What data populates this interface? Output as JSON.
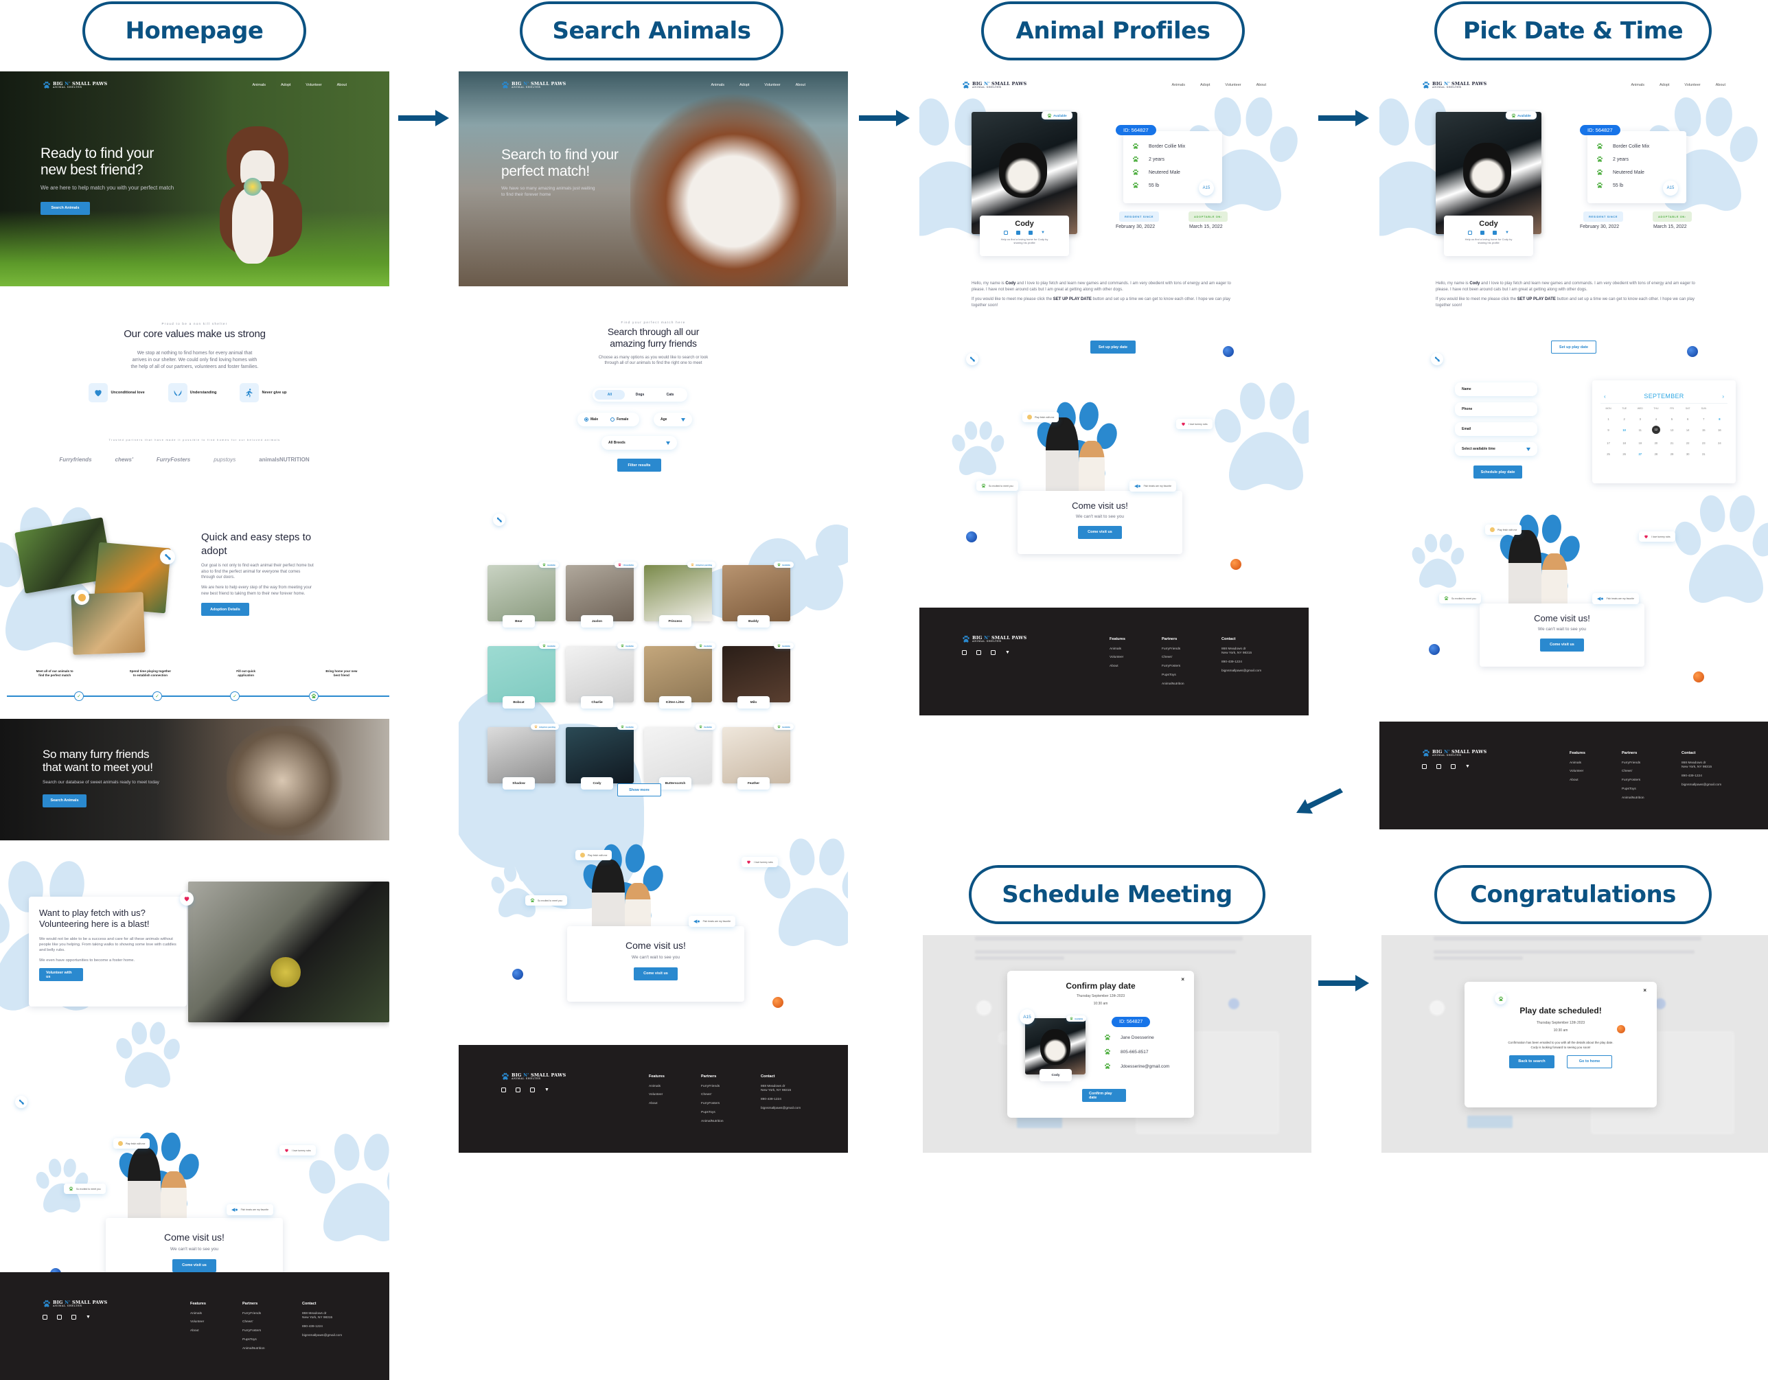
{
  "flow": {
    "stages": [
      {
        "label": "Homepage"
      },
      {
        "label": "Search Animals"
      },
      {
        "label": "Animal Profiles"
      },
      {
        "label": "Pick Date & Time"
      },
      {
        "label": "Schedule Meeting"
      },
      {
        "label": "Congratulations"
      }
    ],
    "accent_color": "#0b5282"
  },
  "brand": {
    "name_part1": "BIG ",
    "name_accent": "N'",
    "name_part2": " SMALL PAWS",
    "subtitle": "ANIMAL SHELTER",
    "primary_color": "#2a89cf"
  },
  "nav": {
    "links": [
      "Animals",
      "Adopt",
      "Volunteer",
      "About"
    ]
  },
  "home": {
    "hero": {
      "title_line1": "Ready to find your",
      "title_line2": "new best friend?",
      "subtitle": "We are here to help match you with your perfect match",
      "cta": "Search Animals"
    },
    "values": {
      "eyebrow": "Proud to be a non kill shelter",
      "title": "Our core values make us strong",
      "body_line1": "We stop at nothing to find homes for every animal that",
      "body_line2": "arrives in our shelter. We could only find loving homes with",
      "body_line3": "the help of all of our partners, volunteers and foster families.",
      "items": [
        {
          "label": "Unconditional love",
          "icon": "heart-icon"
        },
        {
          "label": "Understanding",
          "icon": "hands-icon"
        },
        {
          "label": "Never give up",
          "icon": "running-icon"
        }
      ]
    },
    "partners": {
      "eyebrow": "Trusted partners that have made it possible to find homes for our beloved animals",
      "logos": [
        "Furryfriends",
        "chews'",
        "FurryFosters",
        "pupstoys",
        "animalsNUTRITION"
      ]
    },
    "steps": {
      "title_line1": "Quick and easy steps to",
      "title_line2": "adopt",
      "para1": "Our goal is not only to find each animal their perfect home but also to find the perfect animal for everyone that comes through our doors.",
      "para2": "We are here to help every step of the way from meeting your new best friend to taking them to their new forever home.",
      "cta": "Adoption Details",
      "items": [
        {
          "line1": "Meet all of our animals to",
          "line2": "find the perfect match",
          "icon": "check-icon"
        },
        {
          "line1": "Spend time playing together",
          "line2": "to establish connection",
          "icon": "check-icon"
        },
        {
          "line1": "Fill out quick",
          "line2": "application",
          "icon": "check-icon"
        },
        {
          "line1": "Bring home your new",
          "line2": "best friend",
          "icon": "paw-icon"
        }
      ]
    },
    "banner": {
      "title_line1": "So many furry friends",
      "title_line2": "that want to meet you!",
      "subtitle": "Search our database of sweet animals ready to meet today",
      "cta": "Search Animals"
    },
    "volunteer": {
      "title_line1": "Want to play fetch with us?",
      "title_line2": "Volunteering here is a blast!",
      "para1": "We would not be able to be a success and care for all these animals without people like you helping. From taking walks to showing some love with cuddles and belly rubs.",
      "para2": "We even have opportunities to become a foster home.",
      "cta": "Volunteer with us"
    }
  },
  "visit": {
    "title": "Come visit us!",
    "subtitle": "We can't wait to see you",
    "cta": "Come visit us",
    "bubbles": [
      "Play fetch with me",
      "I love tummy rubs",
      "So excited to meet you",
      "Fish treats are my favorite"
    ]
  },
  "search": {
    "hero": {
      "title_line1": "Search to find your",
      "title_line2": "perfect match!",
      "subtitle_line1": "We have so many amazing animals just waiting",
      "subtitle_line2": "to find their forever home"
    },
    "eyebrow": "Find your perfect match here",
    "title_line1": "Search through all our",
    "title_line2": "amazing furry friends",
    "subtitle_line1": "Choose as many options as you would like to search or look",
    "subtitle_line2": "through all of our animals to find the right one to meet",
    "type_tabs": [
      {
        "label": "All",
        "active": true
      },
      {
        "label": "Dogs",
        "active": false
      },
      {
        "label": "Cats",
        "active": false
      }
    ],
    "gender": {
      "options": [
        "Male",
        "Female"
      ],
      "selected": "Male"
    },
    "age_select": "Age",
    "breed_select": "All Breeds",
    "filter_cta": "Filter results",
    "show_more": "Show more",
    "animals": [
      {
        "name": "Bear",
        "status": "Available"
      },
      {
        "name": "Jaxlon",
        "status": "Unavailable"
      },
      {
        "name": "Princess",
        "status": "Adoption pending"
      },
      {
        "name": "Buddy",
        "status": "Available"
      },
      {
        "name": "Bobcat",
        "status": "Available"
      },
      {
        "name": "Charlie",
        "status": "Available"
      },
      {
        "name": "Kitten Litter",
        "status": "Available"
      },
      {
        "name": "Milo",
        "status": "Available"
      },
      {
        "name": "Shadow",
        "status": "Adoption pending"
      },
      {
        "name": "Cody",
        "status": "Available"
      },
      {
        "name": "Butterscotch",
        "status": "Available"
      },
      {
        "name": "Feather",
        "status": "Available"
      }
    ],
    "status_colors": {
      "Available": "#52b044",
      "Unavailable": "#e6245b",
      "Adoption pending": "#f2b450"
    }
  },
  "profile": {
    "name": "Cody",
    "status": "Available",
    "share_text_line1": "Help us find a loving home for Cody by",
    "share_text_line2": "sharing his profile",
    "id": "ID: 564827",
    "kennel": "A15",
    "details": [
      "Border Collie Mix",
      "2 years",
      "Neutered Male",
      "55 lb"
    ],
    "resident_since_label": "RESIDENT SINCE",
    "resident_since": "February 30, 2022",
    "adoptable_on_label": "ADOPTABLE ON:",
    "adoptable_on": "March 15, 2022",
    "bio_pre": "Hello, my name is ",
    "bio_name": "Cody",
    "bio_post": " and I love to play fetch and learn new games and commands. I am very obedient with tons of energy and am eager to please. I have not been around cats but I am great at getting along with other dogs.",
    "bio2_pre": "If you would like to meet me please click the ",
    "bio2_bold": "SET UP PLAY DATE",
    "bio2_post": " button and set up a time we can get to know each other. I hope we can play together soon!",
    "cta": "Set up play date"
  },
  "schedule_form": {
    "name_placeholder": "Name",
    "phone_placeholder": "Phone",
    "email_placeholder": "Email",
    "time_select": "Select available time",
    "cta": "Schedule play date"
  },
  "calendar": {
    "month": "SEPTEMBER",
    "weekdays": [
      "MON",
      "TUE",
      "WED",
      "THU",
      "FRI",
      "SAT",
      "SUN",
      ""
    ],
    "days": [
      [
        "1",
        "2",
        "3",
        "4",
        "5",
        "6",
        "7",
        "8"
      ],
      [
        "9",
        "10",
        "11",
        "12",
        "13",
        "14",
        "15",
        "16"
      ],
      [
        "17",
        "18",
        "19",
        "20",
        "21",
        "22",
        "23",
        "24"
      ],
      [
        "25",
        "26",
        "27",
        "28",
        "29",
        "30",
        "31",
        ""
      ]
    ],
    "highlighted": [
      "8",
      "10",
      "27"
    ],
    "selected": "12"
  },
  "confirm_modal": {
    "title": "Confirm play date",
    "date": "Thursday September 12th 2023",
    "time": "10:30 am",
    "id": "ID: 564827",
    "kennel": "A15",
    "status": "Available",
    "animal_name": "Cody",
    "contact": [
      "Jane Doesserine",
      "805-665-8517",
      "Jdoesserine@gmail.com"
    ],
    "cta": "Confirm play date",
    "close": "×"
  },
  "success_modal": {
    "title": "Play date scheduled!",
    "date": "Thursday September 12th 2023",
    "time": "10:30 am",
    "message_line1": "Confirmation has been emailed to you with all the details about the play date.",
    "message_line2": "Cody is looking forward to seeing you soon!",
    "primary_cta": "Back to search",
    "secondary_cta": "Go to home",
    "close": "×"
  },
  "footer": {
    "features_title": "Features",
    "features": [
      "Animals",
      "Volunteer",
      "About"
    ],
    "partners_title": "Partners",
    "partners": [
      "FurryFriends",
      "Chews'",
      "FurryFosters",
      "PupsToys",
      "AnimalNutrition"
    ],
    "contact_title": "Contact",
    "address_line1": "868 Meadows dr",
    "address_line2": "New York, NY 98315",
    "phone": "890-439-1224",
    "email": "bignsmallpaws@gmail.com",
    "social": [
      "instagram-icon",
      "facebook-icon",
      "youtube-icon",
      "twitter-icon"
    ]
  }
}
